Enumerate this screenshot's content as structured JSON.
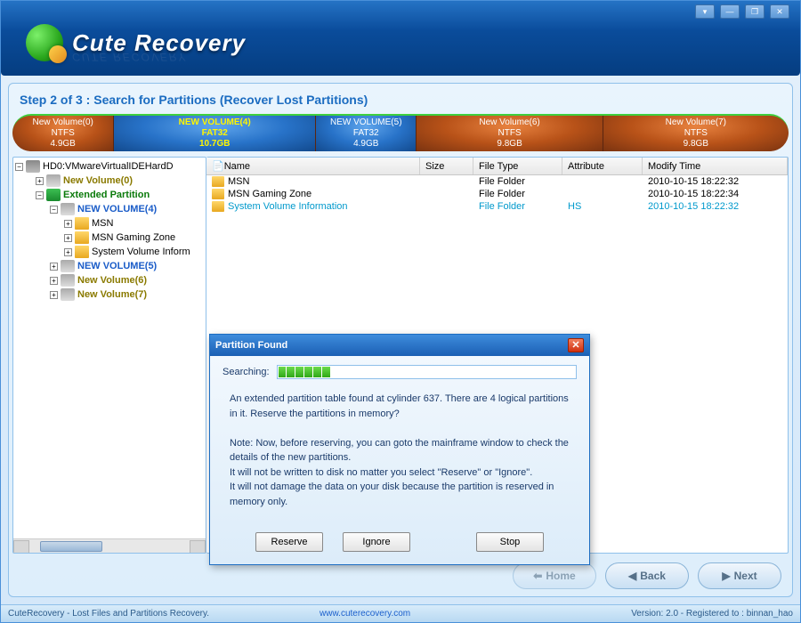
{
  "app": {
    "name": "CuteRecovery",
    "logo_text": "Cute Recovery",
    "logo_ghost": "CUTE RECOVERY"
  },
  "step": {
    "title": "Step 2 of 3 : Search for Partitions (Recover Lost Partitions)"
  },
  "partitions": [
    {
      "label": "New Volume(0)",
      "fs": "NTFS",
      "size": "4.9GB",
      "style": "orange",
      "width": "13%"
    },
    {
      "label": "NEW VOLUME(4)",
      "fs": "FAT32",
      "size": "10.7GB",
      "style": "blue",
      "width": "26%"
    },
    {
      "label": "NEW VOLUME(5)",
      "fs": "FAT32",
      "size": "4.9GB",
      "style": "blue2",
      "width": "13%"
    },
    {
      "label": "New Volume(6)",
      "fs": "NTFS",
      "size": "9.8GB",
      "style": "orange",
      "width": "24%"
    },
    {
      "label": "New Volume(7)",
      "fs": "NTFS",
      "size": "9.8GB",
      "style": "orange",
      "width": "24%"
    }
  ],
  "tree": {
    "root": "HD0:VMwareVirtualIDEHardD",
    "items": [
      {
        "indent": 1,
        "exp": "+",
        "icon": "vol",
        "label": "New Volume(0)",
        "cls": "c-olive"
      },
      {
        "indent": 1,
        "exp": "−",
        "icon": "ext",
        "label": "Extended Partition",
        "cls": "c-green"
      },
      {
        "indent": 2,
        "exp": "−",
        "icon": "vol",
        "label": "NEW VOLUME(4)",
        "cls": "c-blue"
      },
      {
        "indent": 3,
        "exp": "+",
        "icon": "folder",
        "label": "MSN",
        "cls": ""
      },
      {
        "indent": 3,
        "exp": "+",
        "icon": "folder",
        "label": "MSN Gaming Zone",
        "cls": ""
      },
      {
        "indent": 3,
        "exp": "+",
        "icon": "folder",
        "label": "System Volume Inform",
        "cls": ""
      },
      {
        "indent": 2,
        "exp": "+",
        "icon": "vol",
        "label": "NEW VOLUME(5)",
        "cls": "c-blue"
      },
      {
        "indent": 2,
        "exp": "+",
        "icon": "vol",
        "label": "New Volume(6)",
        "cls": "c-olive"
      },
      {
        "indent": 2,
        "exp": "+",
        "icon": "vol",
        "label": "New Volume(7)",
        "cls": "c-olive"
      }
    ]
  },
  "list": {
    "columns": {
      "name": "Name",
      "size": "Size",
      "type": "File Type",
      "attr": "Attribute",
      "time": "Modify Time"
    },
    "rows": [
      {
        "name": "MSN",
        "size": "",
        "type": "File Folder",
        "attr": "",
        "time": "2010-10-15 18:22:32",
        "selected": false
      },
      {
        "name": "MSN Gaming Zone",
        "size": "",
        "type": "File Folder",
        "attr": "",
        "time": "2010-10-15 18:22:34",
        "selected": false
      },
      {
        "name": "System Volume Information",
        "size": "",
        "type": "File Folder",
        "attr": "HS",
        "time": "2010-10-15 18:22:32",
        "selected": true
      }
    ]
  },
  "nav": {
    "home": "Home",
    "back": "Back",
    "next": "Next"
  },
  "status": {
    "left": "CuteRecovery - Lost Files and Partitions Recovery.",
    "link": "www.cuterecovery.com",
    "right": "Version: 2.0 - Registered to : binnan_hao"
  },
  "dialog": {
    "title": "Partition Found",
    "searching_label": "Searching:",
    "msg1": "An extended partition table found at cylinder 637. There are 4 logical partitions in it. Reserve the partitions in memory?",
    "msg2": "Note: Now, before reserving, you can goto the mainframe window to check the details of the new partitions.",
    "msg3": "It will not be written to disk no matter you select \"Reserve\" or \"Ignore\".",
    "msg4": "It will not damage the data on your disk because the partition is reserved in memory only.",
    "btn_reserve": "Reserve",
    "btn_ignore": "Ignore",
    "btn_stop": "Stop"
  }
}
